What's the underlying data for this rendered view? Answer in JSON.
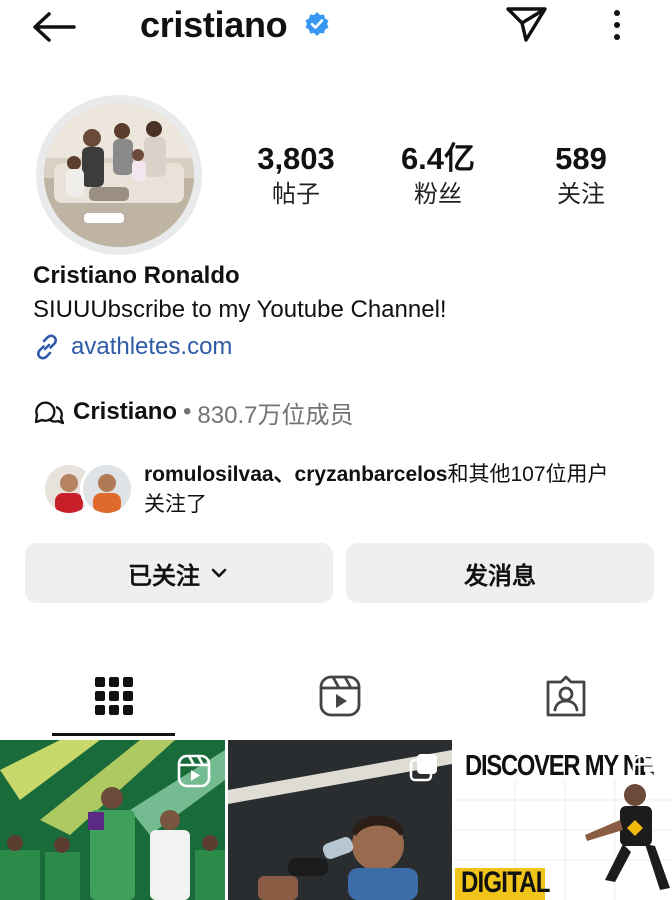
{
  "header": {
    "handle": "cristiano"
  },
  "stats": [
    {
      "value": "3,803",
      "label": "帖子"
    },
    {
      "value": "6.4亿",
      "label": "粉丝"
    },
    {
      "value": "589",
      "label": "关注"
    }
  ],
  "profile": {
    "name": "Cristiano Ronaldo",
    "bio": "SIUUUbscribe to my Youtube Channel!",
    "link": "avathletes.com"
  },
  "channel": {
    "name": "Cristiano",
    "separator": "•",
    "members": "830.7万位成员"
  },
  "followed_by": {
    "users": "romulosilvaa、cryzanbarcelos",
    "rest": "和其他107位用户",
    "line2": "关注了"
  },
  "buttons": {
    "following": "已关注",
    "message": "发消息"
  },
  "tabs": [
    "posts-grid-icon",
    "reels-icon",
    "tagged-icon"
  ],
  "posts": [
    {
      "type": "reel"
    },
    {
      "type": "carousel"
    },
    {
      "type": "reel",
      "caption_line1": "DISCOVER MY NE",
      "caption_line2": "DIGITAL"
    }
  ],
  "colors": {
    "link": "#2e5aa8",
    "verified": "#3897f0",
    "button_bg": "#efefef",
    "muted": "#737373"
  }
}
